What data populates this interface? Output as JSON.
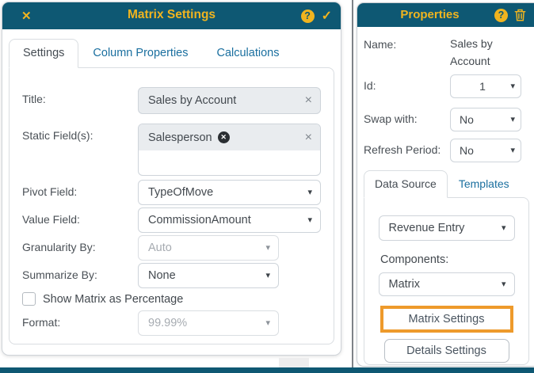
{
  "icons": {
    "close": "✕",
    "help": "?",
    "confirm": "✓",
    "caret": "▾",
    "clear": "×",
    "chip_remove": "✕"
  },
  "colors": {
    "header_teal": "#0e5873",
    "accent_yellow": "#f0b41f",
    "link_blue": "#1a6f9f",
    "highlight_orange": "#ee9a2b"
  },
  "left_dialog": {
    "title": "Matrix Settings",
    "tabs": [
      {
        "label": "Settings",
        "active": true
      },
      {
        "label": "Column Properties",
        "active": false
      },
      {
        "label": "Calculations",
        "active": false
      }
    ],
    "rows": {
      "title": {
        "label": "Title:",
        "value": "Sales by Account"
      },
      "static_fields": {
        "label": "Static Field(s):",
        "chip": "Salesperson"
      },
      "pivot_field": {
        "label": "Pivot Field:",
        "value": "TypeOfMove"
      },
      "value_field": {
        "label": "Value Field:",
        "value": "CommissionAmount"
      },
      "granularity_by": {
        "label": "Granularity By:",
        "value": "Auto",
        "disabled": true
      },
      "summarize_by": {
        "label": "Summarize By:",
        "value": "None"
      },
      "show_matrix": {
        "label": "Show Matrix as Percentage",
        "checked": false
      },
      "format": {
        "label": "Format:",
        "value": "99.99%",
        "disabled": true
      }
    }
  },
  "right_panel": {
    "title": "Properties",
    "rows": {
      "name": {
        "label": "Name:",
        "value": "Sales by Account"
      },
      "id": {
        "label": "Id:",
        "value": "1"
      },
      "swap_with": {
        "label": "Swap with:",
        "value": "No"
      },
      "refresh_period": {
        "label": "Refresh Period:",
        "value": "No"
      }
    },
    "tabs": [
      {
        "label": "Data Source",
        "active": true
      },
      {
        "label": "Templates",
        "active": false
      }
    ],
    "data_source": {
      "source_value": "Revenue Entry",
      "components_label": "Components:",
      "components_value": "Matrix",
      "matrix_settings_button": "Matrix Settings",
      "details_settings_button": "Details Settings"
    }
  }
}
